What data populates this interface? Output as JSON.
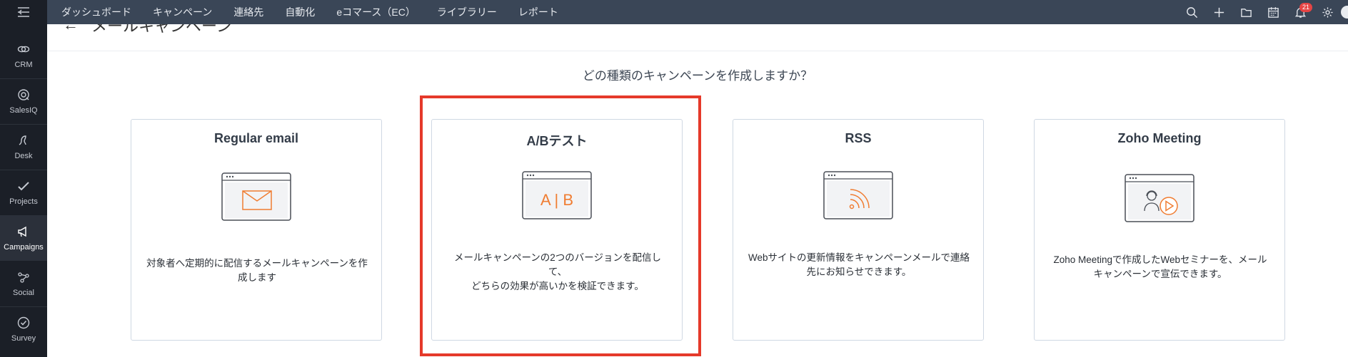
{
  "rail": {
    "items": [
      {
        "label": "CRM",
        "icon": "crm-icon"
      },
      {
        "label": "SalesIQ",
        "icon": "salesiq-icon"
      },
      {
        "label": "Desk",
        "icon": "desk-icon"
      },
      {
        "label": "Projects",
        "icon": "projects-icon"
      },
      {
        "label": "Campaigns",
        "icon": "campaigns-icon"
      },
      {
        "label": "Social",
        "icon": "social-icon"
      },
      {
        "label": "Survey",
        "icon": "survey-icon"
      }
    ],
    "active": "Campaigns"
  },
  "nav": {
    "items": [
      "ダッシュボード",
      "キャンペーン",
      "連絡先",
      "自動化",
      "eコマース（EC）",
      "ライブラリー",
      "レポート"
    ]
  },
  "topbar": {
    "notification_count": "21"
  },
  "page": {
    "title": "メールキャンペーン",
    "question": "どの種類のキャンペーンを作成しますか？"
  },
  "cards": [
    {
      "title": "Regular email",
      "desc_line1": "対象者へ定期的に配信するメールキャンペーンを作",
      "desc_line2": "成します",
      "icon": "email-envelope-icon"
    },
    {
      "title": "A/Bテスト",
      "art_text": "A | B",
      "desc_line1": "メールキャンペーンの2つのバージョンを配信して、",
      "desc_line2": "どちらの効果が高いかを検証できます。",
      "icon": "ab-test-icon"
    },
    {
      "title": "RSS",
      "desc_line1": "Webサイトの更新情報をキャンペーンメールで連絡",
      "desc_line2": "先にお知らせできます。",
      "icon": "rss-icon"
    },
    {
      "title": "Zoho Meeting",
      "desc_line1": "Zoho Meetingで作成したWebセミナーを、メール",
      "desc_line2": "キャンペーンで宣伝できます。",
      "icon": "webinar-icon"
    }
  ],
  "colors": {
    "accent": "#f07d32",
    "highlight": "#e5392a",
    "topbar": "#3a4657",
    "rail": "#1b1f27"
  }
}
